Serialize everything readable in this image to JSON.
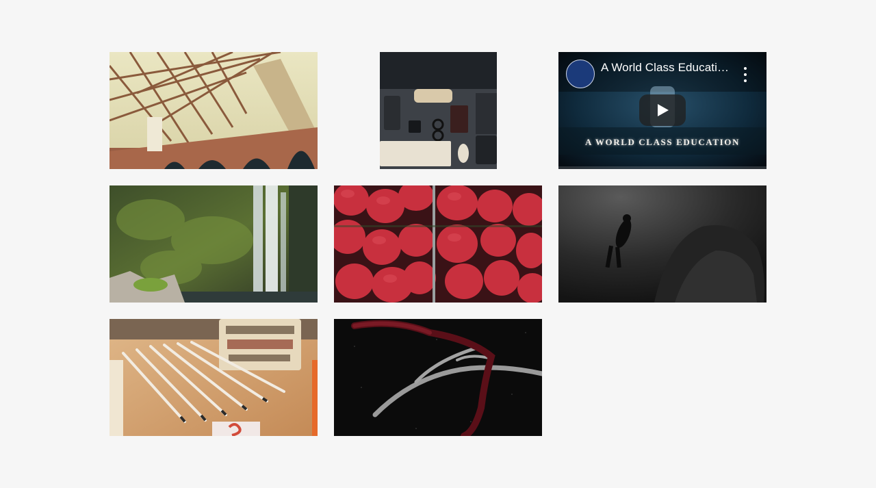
{
  "gallery": {
    "items": [
      {
        "kind": "image",
        "subject": "bridge"
      },
      {
        "kind": "image",
        "subject": "desk"
      },
      {
        "kind": "video",
        "title": "A World Class Education",
        "title_display": "A World Class Educati…",
        "caption": "A WORLD CLASS EDUCATION",
        "icon": "play-icon"
      },
      {
        "kind": "image",
        "subject": "waterfall"
      },
      {
        "kind": "image",
        "subject": "strawberries"
      },
      {
        "kind": "image",
        "subject": "diver"
      },
      {
        "kind": "image",
        "subject": "pencils"
      },
      {
        "kind": "image",
        "subject": "antler"
      }
    ]
  },
  "colors": {
    "background": "#f6f6f6",
    "video_dark": "#0f2433"
  }
}
